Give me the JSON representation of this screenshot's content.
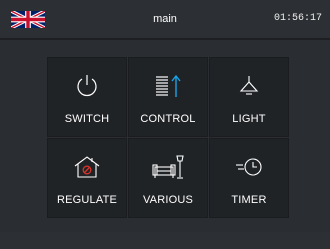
{
  "header": {
    "title": "main",
    "time": "01:56:17",
    "language_flag": "uk-flag-icon"
  },
  "tiles": [
    {
      "label": "SWITCH",
      "icon": "power-icon"
    },
    {
      "label": "CONTROL",
      "icon": "control-icon"
    },
    {
      "label": "LIGHT",
      "icon": "lamp-icon"
    },
    {
      "label": "REGULATE",
      "icon": "house-regulate-icon"
    },
    {
      "label": "VARIOUS",
      "icon": "sofa-lamp-icon"
    },
    {
      "label": "TIMER",
      "icon": "clock-icon"
    }
  ],
  "colors": {
    "background": "#2a2d31",
    "tile": "#202326",
    "accent_blue": "#1aa3e8",
    "accent_red": "#d8322a",
    "text": "#ffffff"
  }
}
